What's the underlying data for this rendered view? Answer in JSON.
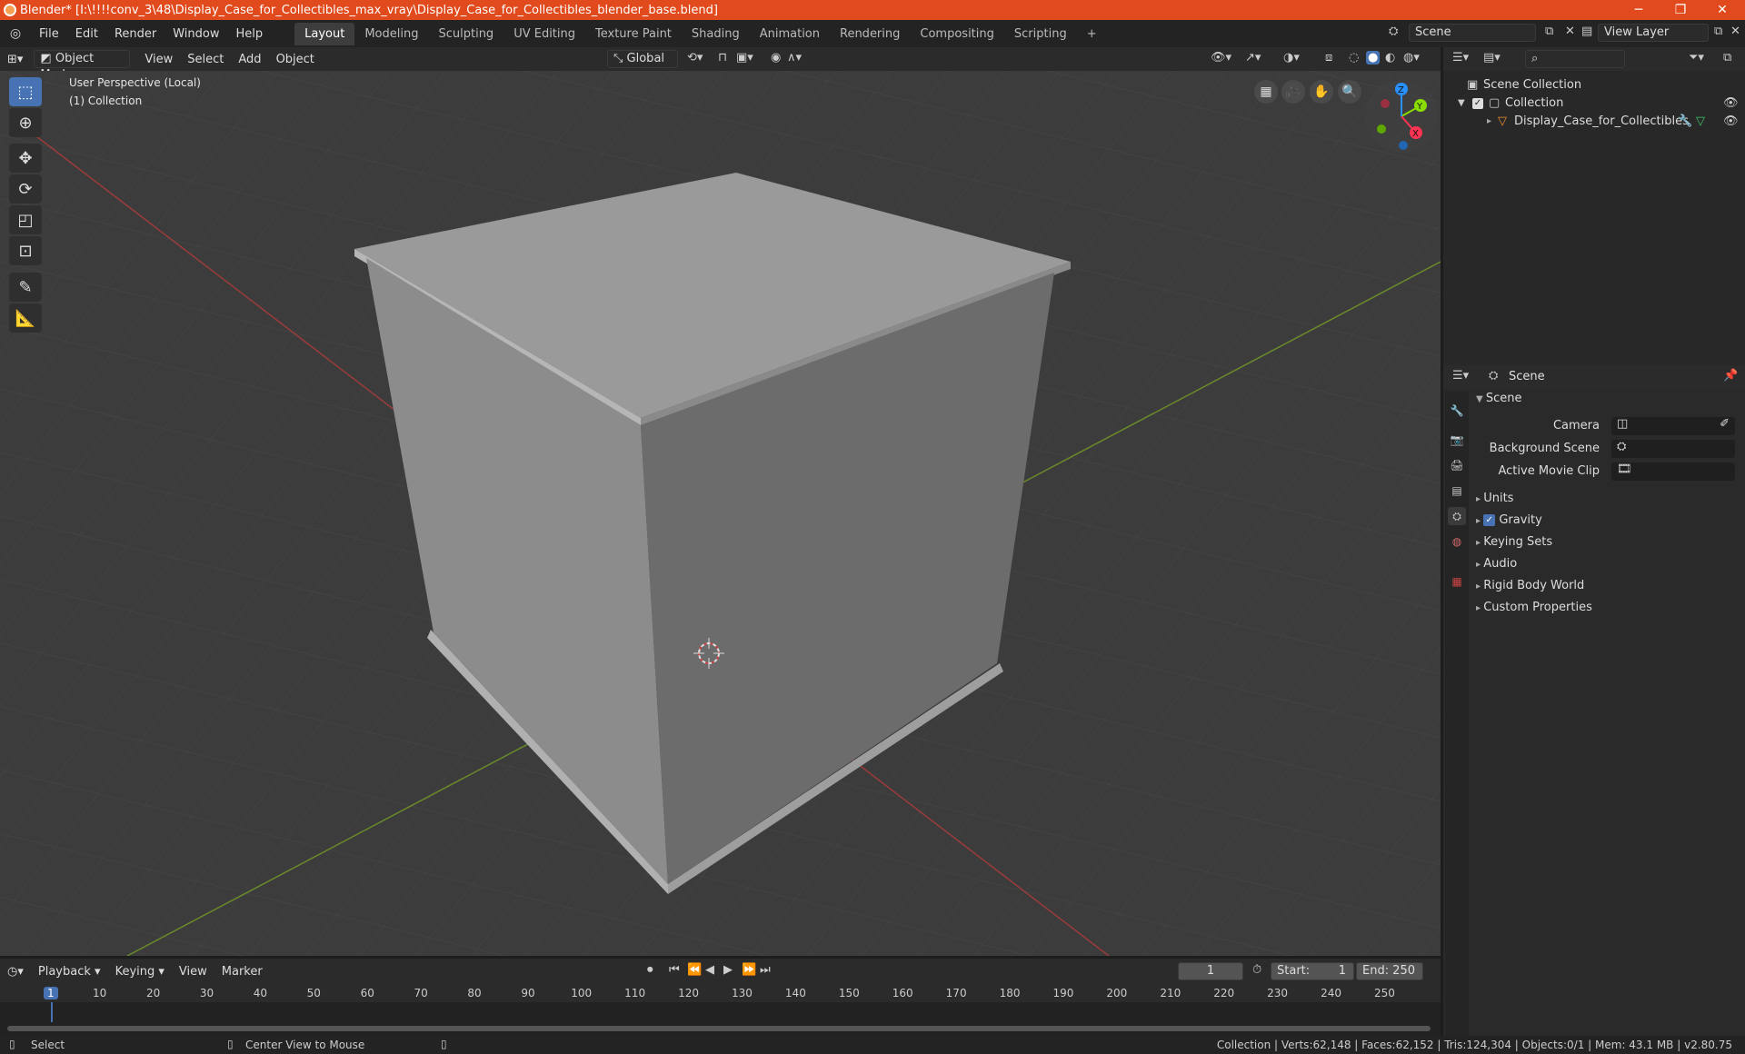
{
  "window": {
    "title": "Blender* [I:\\!!!!conv_3\\48\\Display_Case_for_Collectibles_max_vray\\Display_Case_for_Collectibles_blender_base.blend]",
    "minimize": "─",
    "restore": "❐",
    "close": "✕"
  },
  "menu": {
    "items": [
      "File",
      "Edit",
      "Render",
      "Window",
      "Help"
    ]
  },
  "workspaces": [
    "Layout",
    "Modeling",
    "Sculpting",
    "UV Editing",
    "Texture Paint",
    "Shading",
    "Animation",
    "Rendering",
    "Compositing",
    "Scripting"
  ],
  "workspace_add": "+",
  "scene": {
    "name": "Scene",
    "view_layer": "View Layer"
  },
  "viewport_header": {
    "mode": "Object Mode",
    "view": "View",
    "select": "Select",
    "add": "Add",
    "object": "Object",
    "transform": "Global"
  },
  "viewport": {
    "perspective": "User Perspective (Local)",
    "collection": "(1) Collection",
    "gizmo": {
      "z": "Z",
      "y": "Y",
      "x": "X"
    }
  },
  "outliner": {
    "search_placeholder": "",
    "root": "Scene Collection",
    "collection": "Collection",
    "object": "Display_Case_for_Collectibles"
  },
  "properties": {
    "header": "Scene",
    "section": "Scene",
    "camera_label": "Camera",
    "bg_scene_label": "Background Scene",
    "movie_clip_label": "Active Movie Clip",
    "sections": [
      "Units",
      "Gravity",
      "Keying Sets",
      "Audio",
      "Rigid Body World",
      "Custom Properties"
    ]
  },
  "timeline": {
    "playback": "Playback",
    "keying": "Keying",
    "view": "View",
    "marker": "Marker",
    "current_frame": "1",
    "start_label": "Start:",
    "start": "1",
    "end_label": "End:",
    "end": "250",
    "ticks": [
      "1",
      "10",
      "20",
      "30",
      "40",
      "50",
      "60",
      "70",
      "80",
      "90",
      "100",
      "110",
      "120",
      "130",
      "140",
      "150",
      "160",
      "170",
      "180",
      "190",
      "200",
      "210",
      "220",
      "230",
      "240",
      "250"
    ]
  },
  "status": {
    "select": "Select",
    "center": "Center View to Mouse",
    "stats": "Collection | Verts:62,148 | Faces:62,152 | Tris:124,304 | Objects:0/1 | Mem: 43.1 MB | v2.80.75"
  },
  "colors": {
    "accent": "#4772b3",
    "titlebar": "#e04a1c",
    "x_axis": "#ff3352",
    "y_axis": "#8bdc00",
    "z_axis": "#2890ff"
  }
}
